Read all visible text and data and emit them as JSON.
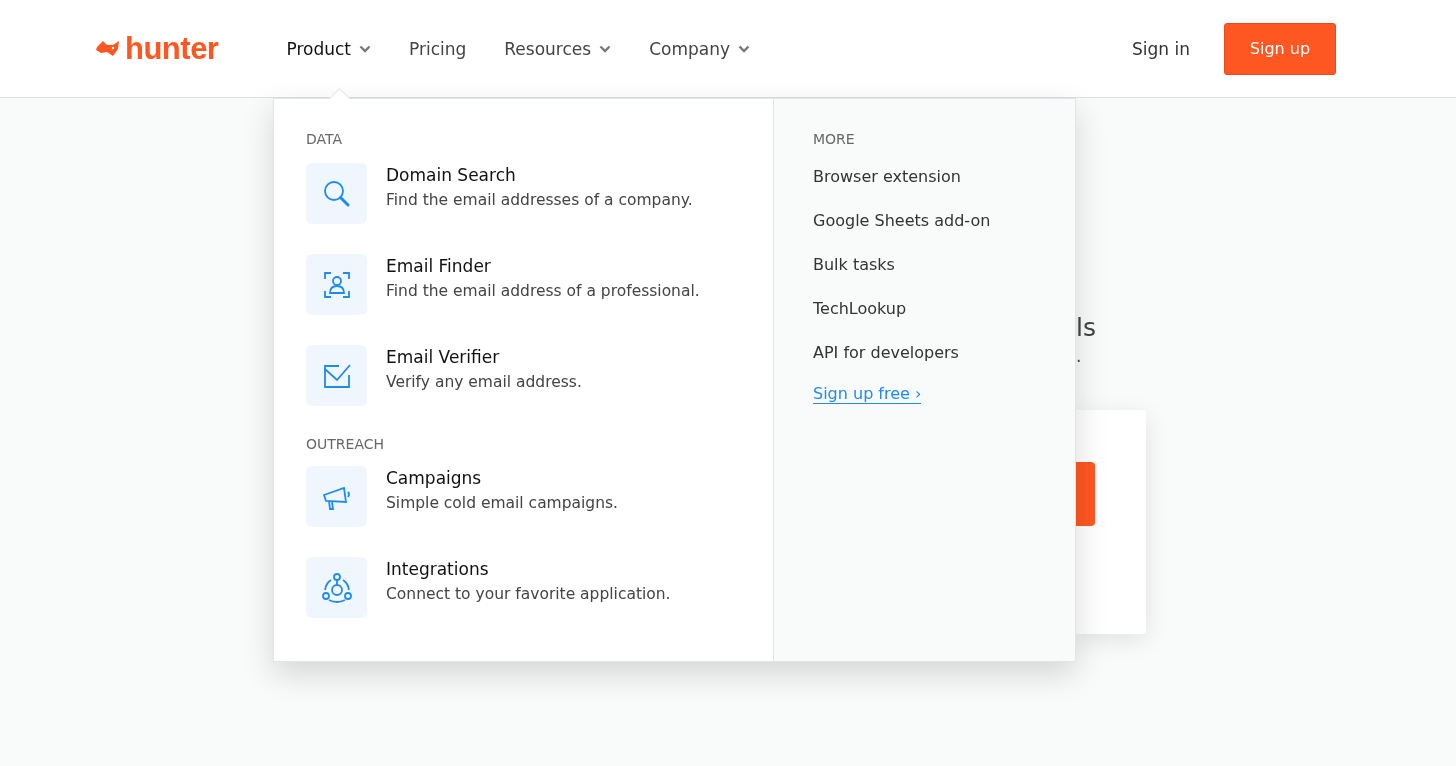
{
  "logo": {
    "text": "hunter"
  },
  "nav": [
    {
      "label": "Product",
      "dropdown": true,
      "selected": true
    },
    {
      "label": "Pricing",
      "dropdown": false,
      "selected": false
    },
    {
      "label": "Resources",
      "dropdown": true,
      "selected": false
    },
    {
      "label": "Company",
      "dropdown": true,
      "selected": false
    }
  ],
  "sign_in": "Sign in",
  "sign_up": "Sign up",
  "background": {
    "heading_fragment": "ls",
    "text_fragment": "."
  },
  "menu": {
    "sections": [
      {
        "title": "DATA",
        "items": [
          {
            "kind": "search",
            "title": "Domain Search",
            "description": "Find the email addresses of a company."
          },
          {
            "kind": "person",
            "title": "Email Finder",
            "description": "Find the email address of a professional."
          },
          {
            "kind": "verify",
            "title": "Email Verifier",
            "description": "Verify any email address."
          }
        ]
      },
      {
        "title": "OUTREACH",
        "items": [
          {
            "kind": "megaphone",
            "title": "Campaigns",
            "description": "Simple cold email campaigns."
          },
          {
            "kind": "network",
            "title": "Integrations",
            "description": "Connect to your favorite application."
          }
        ]
      }
    ],
    "more": {
      "title": "MORE",
      "links": [
        "Browser extension",
        "Google Sheets add-on",
        "Bulk tasks",
        "TechLookup",
        "API for developers"
      ],
      "cta": "Sign up free ›"
    }
  }
}
